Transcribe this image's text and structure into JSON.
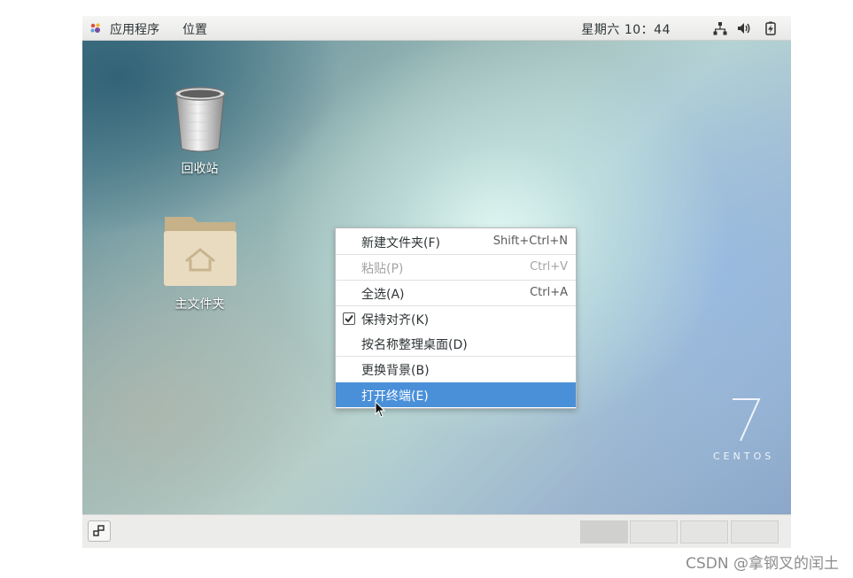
{
  "topbar": {
    "apps_label": "应用程序",
    "places_label": "位置",
    "clock": "星期六 10：44",
    "icons": [
      "gnome-foot-icon",
      "network-icon",
      "volume-icon",
      "battery-icon"
    ]
  },
  "desktop": {
    "icons": [
      {
        "label": "回收站",
        "icon": "trash-icon"
      },
      {
        "label": "主文件夹",
        "icon": "home-folder-icon"
      }
    ],
    "branding": {
      "number": "7",
      "text": "CENTOS"
    }
  },
  "context_menu": {
    "items": [
      {
        "label": "新建文件夹(F)",
        "shortcut": "Shift+Ctrl+N",
        "enabled": true
      },
      {
        "label": "粘贴(P)",
        "shortcut": "Ctrl+V",
        "enabled": false
      },
      {
        "label": "全选(A)",
        "shortcut": "Ctrl+A",
        "enabled": true
      },
      {
        "label": "保持对齐(K)",
        "checked": true,
        "enabled": true
      },
      {
        "label": "按名称整理桌面(D)",
        "enabled": true
      },
      {
        "label": "更换背景(B)",
        "enabled": true
      },
      {
        "label": "打开终端(E)",
        "enabled": true,
        "highlighted": true
      }
    ]
  },
  "bottombar": {
    "workspaces": 4,
    "active_workspace": 1
  },
  "watermark": "CSDN @拿钢叉的闰土",
  "colors": {
    "menu_highlight": "#4a90d9",
    "panel_bg": "#ecedeb"
  }
}
